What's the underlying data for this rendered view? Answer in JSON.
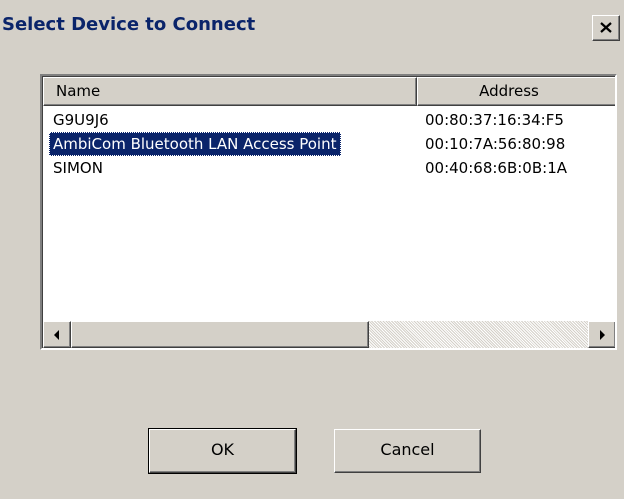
{
  "window": {
    "title": "Select Device to Connect",
    "close_icon": "close-icon"
  },
  "list": {
    "columns": [
      "Name",
      "Address"
    ],
    "rows": [
      {
        "name": "G9U9J6",
        "address": "00:80:37:16:34:F5",
        "selected": false
      },
      {
        "name": "AmbiCom Bluetooth LAN Access Point",
        "address": "00:10:7A:56:80:98",
        "selected": true
      },
      {
        "name": "SIMON",
        "address": "00:40:68:6B:0B:1A",
        "selected": false
      }
    ]
  },
  "scrollbar": {
    "left_icon": "arrow-left-icon",
    "right_icon": "arrow-right-icon"
  },
  "buttons": {
    "ok_label": "OK",
    "cancel_label": "Cancel"
  },
  "colors": {
    "dialog_bg": "#d4d0c8",
    "title_text": "#0a246a",
    "selection_bg": "#0a246a"
  }
}
